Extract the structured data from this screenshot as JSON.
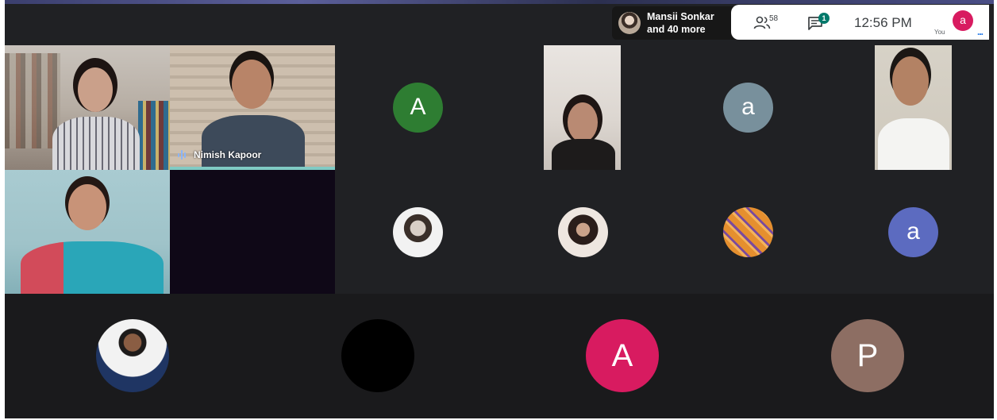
{
  "presenter": {
    "name": "Mansii Sonkar",
    "more": "and 40 more"
  },
  "toolbar": {
    "people_count": "58",
    "chat_badge": "1",
    "time": "12:56 PM",
    "you_label": "You",
    "self_initial": "a",
    "more_glyph": "..."
  },
  "tiles": {
    "nimish": {
      "name": "Nimish Kapoor"
    }
  },
  "avatars": {
    "a_green": {
      "initial": "A",
      "color": "#2e7d32"
    },
    "a_gray": {
      "initial": "a",
      "color": "#78909c"
    },
    "a_blue": {
      "initial": "a",
      "color": "#5c6bc0"
    },
    "a_pink": {
      "initial": "A",
      "color": "#d81b60"
    },
    "p_brown": {
      "initial": "P",
      "color": "#8d6e63"
    }
  },
  "colors": {
    "background": "#202124",
    "speaking_border": "#80cbc4",
    "chat_badge": "#00796b",
    "accent": "#1a73e8"
  },
  "icons": [
    "people-icon",
    "chat-icon",
    "audio-wave-icon",
    "more-icon"
  ]
}
